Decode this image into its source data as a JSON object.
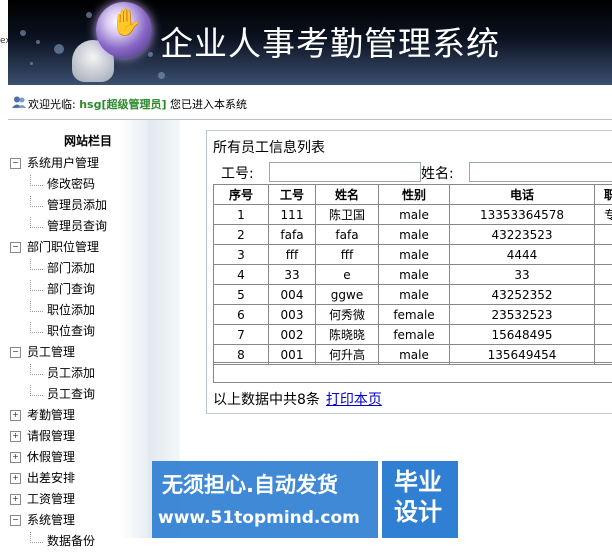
{
  "left_clip": "ex",
  "header": {
    "title": "企业人事考勤管理系统"
  },
  "welcome": {
    "prefix": "欢迎光临:",
    "user": "hsg[超级管理员]",
    "suffix": "您已进入本系统"
  },
  "sidebar": {
    "title": "网站栏目",
    "items": [
      {
        "label": "系统用户管理",
        "level": 0,
        "expanded": true
      },
      {
        "label": "修改密码",
        "level": 1
      },
      {
        "label": "管理员添加",
        "level": 1
      },
      {
        "label": "管理员查询",
        "level": 1
      },
      {
        "label": "部门职位管理",
        "level": 0,
        "expanded": true
      },
      {
        "label": "部门添加",
        "level": 1
      },
      {
        "label": "部门查询",
        "level": 1
      },
      {
        "label": "职位添加",
        "level": 1
      },
      {
        "label": "职位查询",
        "level": 1
      },
      {
        "label": "员工管理",
        "level": 0,
        "expanded": true
      },
      {
        "label": "员工添加",
        "level": 1
      },
      {
        "label": "员工查询",
        "level": 1
      },
      {
        "label": "考勤管理",
        "level": 0,
        "expanded": false
      },
      {
        "label": "请假管理",
        "level": 0,
        "expanded": false
      },
      {
        "label": "休假管理",
        "level": 0,
        "expanded": false
      },
      {
        "label": "出差安排",
        "level": 0,
        "expanded": false
      },
      {
        "label": "工资管理",
        "level": 0,
        "expanded": false
      },
      {
        "label": "系统管理",
        "level": 0,
        "expanded": true
      },
      {
        "label": "数据备份",
        "level": 1
      }
    ]
  },
  "main": {
    "title": "所有员工信息列表",
    "search": {
      "id_label": "工号:",
      "name_label": "姓名:",
      "id_value": "",
      "name_value": ""
    },
    "table": {
      "columns": [
        "序号",
        "工号",
        "姓名",
        "性别",
        "电话",
        "职"
      ],
      "rows": [
        [
          "1",
          "111",
          "陈卫国",
          "male",
          "13353364578",
          "专"
        ],
        [
          "2",
          "fafa",
          "fafa",
          "male",
          "43223523",
          ""
        ],
        [
          "3",
          "fff",
          "fff",
          "male",
          "4444",
          ""
        ],
        [
          "4",
          "33",
          "e",
          "male",
          "33",
          ""
        ],
        [
          "5",
          "004",
          "ggwe",
          "male",
          "43252352",
          ""
        ],
        [
          "6",
          "003",
          "何秀微",
          "female",
          "23532523",
          ""
        ],
        [
          "7",
          "002",
          "陈晓晓",
          "female",
          "15648495",
          ""
        ],
        [
          "8",
          "001",
          "何升高",
          "male",
          "135649454",
          ""
        ]
      ]
    },
    "summary": "以上数据中共8条",
    "print_link": "打印本页"
  },
  "watermark": {
    "line1": "无须担心.自动发货",
    "line2": "www.51topmind.com",
    "box": "毕业设计"
  }
}
